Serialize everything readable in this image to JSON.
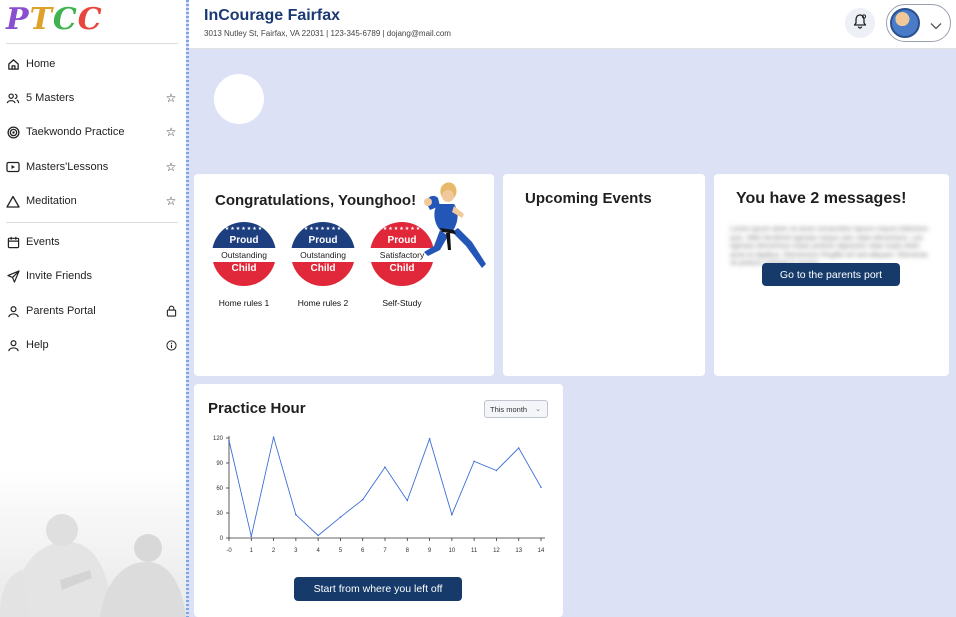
{
  "brand": {
    "letters": [
      "P",
      "T",
      "C",
      "C"
    ]
  },
  "sidebar": {
    "items": [
      {
        "label": "Home",
        "icon": "home-icon",
        "right_icon": ""
      },
      {
        "label": "5 Masters",
        "icon": "users-icon",
        "right_icon": "star-icon"
      },
      {
        "label": "Taekwondo Practice",
        "icon": "target-icon",
        "right_icon": "star-icon"
      },
      {
        "label": "Masters'Lessons",
        "icon": "video-icon",
        "right_icon": "star-icon"
      },
      {
        "label": "Meditation",
        "icon": "triangle-icon",
        "right_icon": "star-icon"
      },
      {
        "label": "Events",
        "icon": "calendar-icon",
        "right_icon": ""
      },
      {
        "label": "Invite Friends",
        "icon": "send-icon",
        "right_icon": ""
      },
      {
        "label": "Parents Portal",
        "icon": "user-icon",
        "right_icon": "lock-icon"
      },
      {
        "label": "Help",
        "icon": "user-icon",
        "right_icon": "info-icon"
      }
    ]
  },
  "header": {
    "title": "InCourage Fairfax",
    "subtitle": "3013 Nutley St, Fairfax, VA 22031  |  123-345-6789 |  dojang@mail.com"
  },
  "congrats": {
    "title": "Congratulations, Younghoo!",
    "badges": [
      {
        "top": "Proud",
        "middle": "Outstanding",
        "bottom": "Child",
        "caption": "Home rules 1",
        "color": "#1d3f7f"
      },
      {
        "top": "Proud",
        "middle": "Outstanding",
        "bottom": "Child",
        "caption": "Home rules 2",
        "color": "#1d3f7f"
      },
      {
        "top": "Proud",
        "middle": "Satisfactory",
        "bottom": "Child",
        "caption": "Self-Study",
        "color": "#e0283a"
      }
    ]
  },
  "events": {
    "title": "Upcoming Events"
  },
  "messages": {
    "title": "You have 2 messages!",
    "blurred_text": "Lorem ipsum dolor sit amet consectetur lipsum mauris tellentum quis. Nibh hendrerit egestas neque nam vitae elementum. Leo egestas elementum turpis pretium dignissim vitae turpis dolor amet et dapibus. Elementum fringilla vel sed aliquam. Elementa sit pretium volutpat in ornare.",
    "button": "Go to the parents port"
  },
  "practice": {
    "title": "Practice Hour",
    "select_value": "This month",
    "button": "Start from where you left off"
  },
  "colors": {
    "accent": "#163a6a",
    "line": "#3d6fd6",
    "page_bg": "#dde1f5"
  },
  "chart_data": {
    "type": "line",
    "title": "Practice Hour",
    "x": [
      0,
      1,
      2,
      3,
      4,
      5,
      6,
      7,
      8,
      9,
      10,
      11,
      12,
      13,
      14
    ],
    "x_tick_labels": [
      "-0",
      "1",
      "2",
      "3",
      "4",
      "5",
      "6",
      "7",
      "8",
      "9",
      "10",
      "11",
      "12",
      "13",
      "14"
    ],
    "series": [
      {
        "values": [
          117,
          2,
          121,
          28,
          3,
          25,
          46,
          85,
          45,
          119,
          28,
          92,
          81,
          108,
          61
        ]
      }
    ],
    "yticks": [
      0,
      30,
      60,
      90,
      120
    ],
    "ylim": [
      0,
      120
    ],
    "xlim": [
      0,
      14
    ],
    "grid": false
  }
}
